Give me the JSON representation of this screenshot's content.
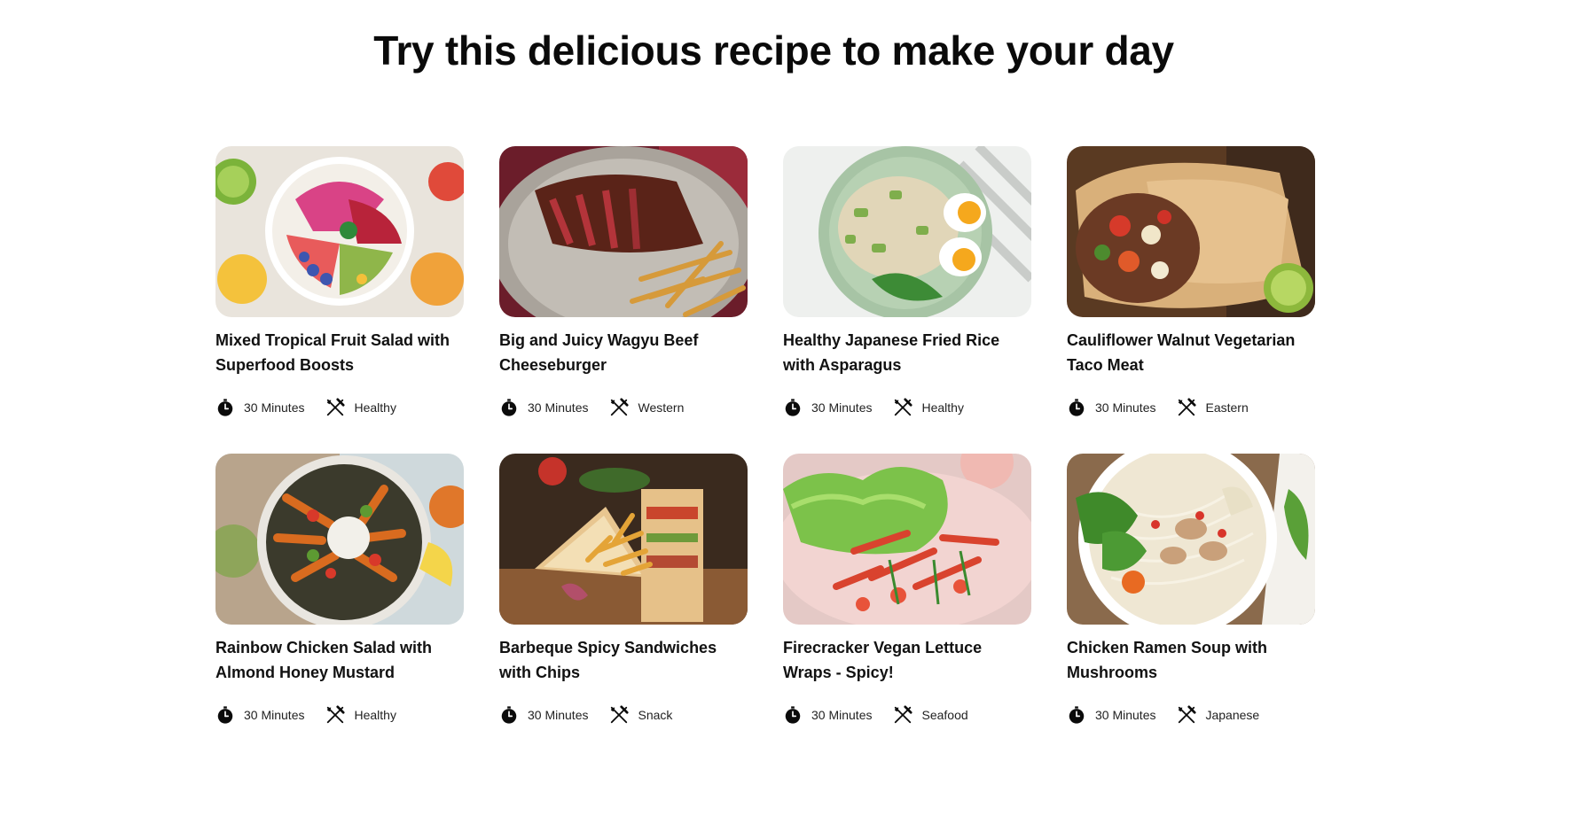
{
  "page": {
    "title": "Try this delicious recipe to make your day"
  },
  "recipes": [
    {
      "title": "Mixed Tropical Fruit Salad with Superfood Boosts",
      "time": "30 Minutes",
      "category": "Healthy",
      "photo": "fruit-bowl"
    },
    {
      "title": "Big and Juicy Wagyu Beef Cheeseburger",
      "time": "30 Minutes",
      "category": "Western",
      "photo": "steak-fries"
    },
    {
      "title": "Healthy Japanese Fried Rice with Asparagus",
      "time": "30 Minutes",
      "category": "Healthy",
      "photo": "fried-rice"
    },
    {
      "title": "Cauliflower Walnut Vegetarian Taco Meat",
      "time": "30 Minutes",
      "category": "Eastern",
      "photo": "burrito"
    },
    {
      "title": "Rainbow Chicken Salad with Almond Honey Mustard",
      "time": "30 Minutes",
      "category": "Healthy",
      "photo": "chicken-salad"
    },
    {
      "title": "Barbeque Spicy Sandwiches with Chips",
      "time": "30 Minutes",
      "category": "Snack",
      "photo": "sandwich"
    },
    {
      "title": "Firecracker Vegan Lettuce Wraps - Spicy!",
      "time": "30 Minutes",
      "category": "Seafood",
      "photo": "lettuce-wraps"
    },
    {
      "title": "Chicken Ramen Soup with Mushrooms",
      "time": "30 Minutes",
      "category": "Japanese",
      "photo": "ramen"
    }
  ],
  "icons": {
    "time": "timer-icon",
    "category": "fork-knife-icon"
  }
}
